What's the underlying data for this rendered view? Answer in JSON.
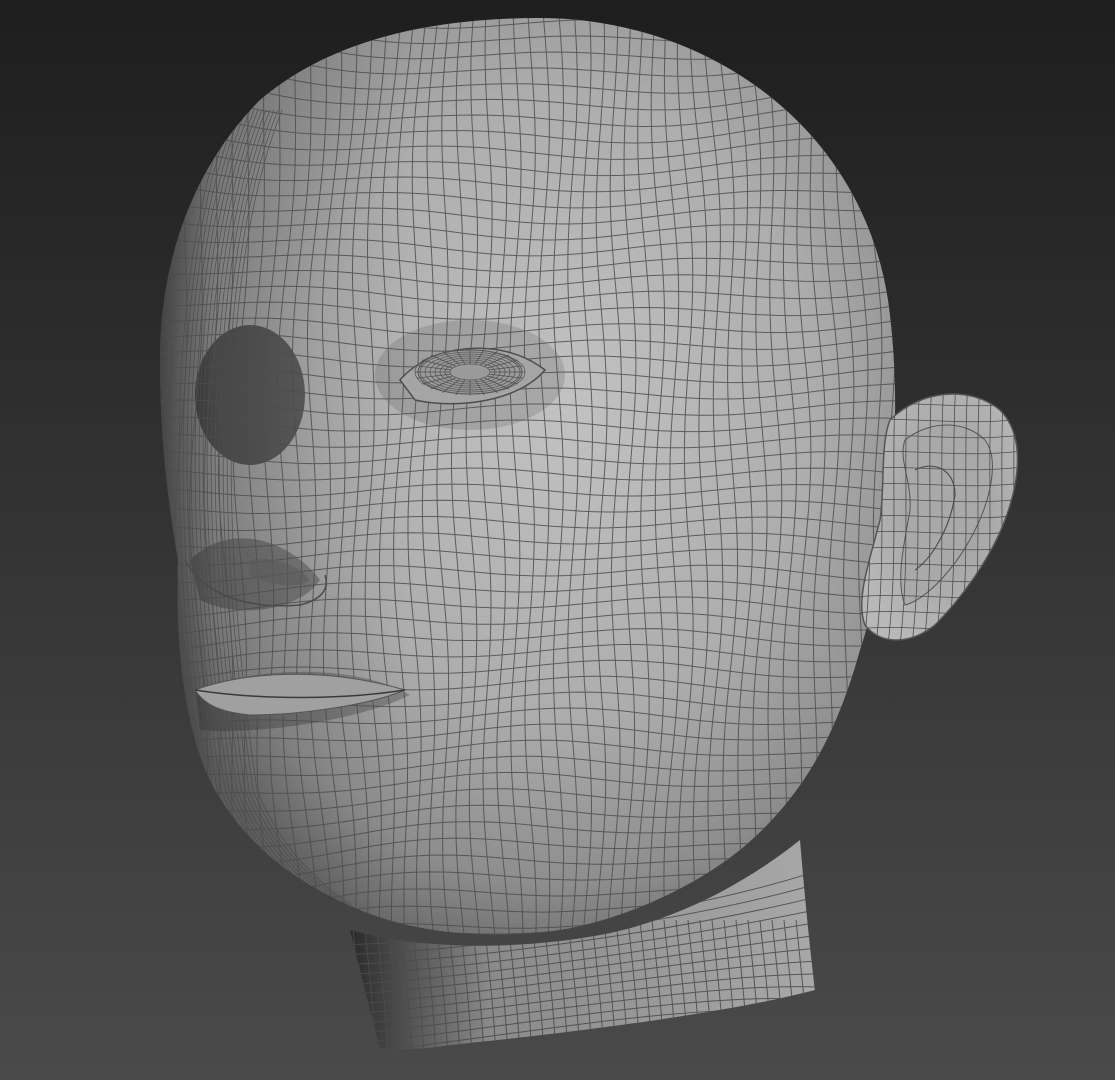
{
  "viewport": {
    "subject": "head-wireframe-mesh",
    "background_top": "#1e1e1e",
    "background_bottom": "#4a4a4a",
    "surface_light": "#bdbdbd",
    "surface_dark": "#6a6a6a",
    "wire_color": "#4d4d4d"
  }
}
